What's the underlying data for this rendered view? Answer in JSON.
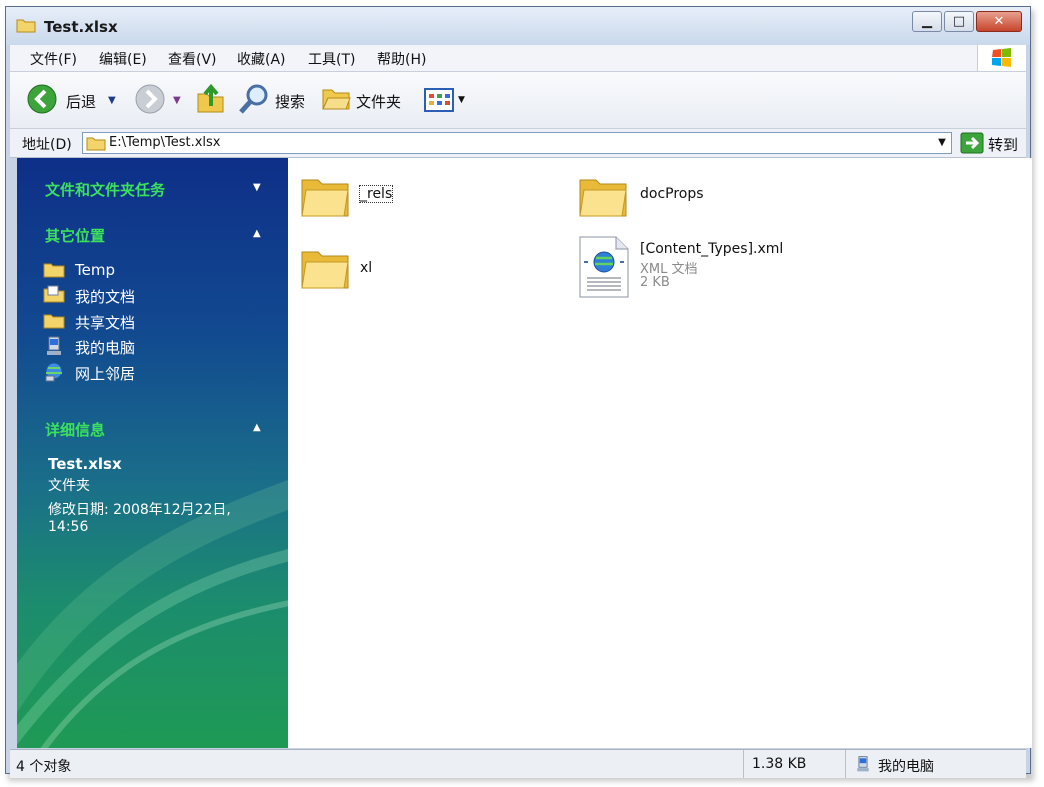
{
  "window": {
    "title": "Test.xlsx"
  },
  "menu": [
    "文件(F)",
    "编辑(E)",
    "查看(V)",
    "收藏(A)",
    "工具(T)",
    "帮助(H)"
  ],
  "toolbar": {
    "back_label": "后退",
    "search_label": "搜索",
    "folders_label": "文件夹"
  },
  "address": {
    "label": "地址(D)",
    "path": "E:\\Temp\\Test.xlsx",
    "go_label": "转到"
  },
  "sidebar": {
    "tasks_title": "文件和文件夹任务",
    "places_title": "其它位置",
    "places": [
      "Temp",
      "我的文档",
      "共享文档",
      "我的电脑",
      "网上邻居"
    ],
    "details_title": "详细信息",
    "details": {
      "name": "Test.xlsx",
      "type": "文件夹",
      "modified_line1": "修改日期: 2008年12月22日,",
      "modified_line2": "14:56"
    }
  },
  "files": [
    {
      "name": "_rels",
      "kind": "folder"
    },
    {
      "name": "docProps",
      "kind": "folder"
    },
    {
      "name": "xl",
      "kind": "folder"
    },
    {
      "name": "[Content_Types].xml",
      "kind": "xml",
      "type": "XML 文档",
      "size": "2 KB"
    }
  ],
  "status": {
    "count": "4 个对象",
    "size": "1.38 KB",
    "location": "我的电脑"
  }
}
